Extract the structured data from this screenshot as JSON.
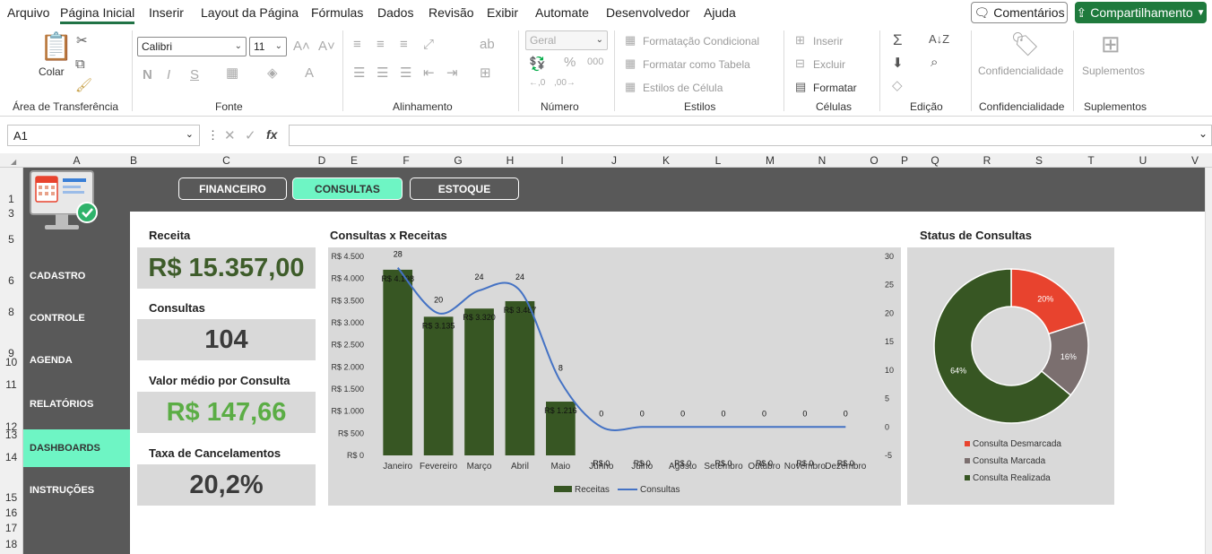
{
  "menu": {
    "items": [
      "Arquivo",
      "Página Inicial",
      "Inserir",
      "Layout da Página",
      "Fórmulas",
      "Dados",
      "Revisão",
      "Exibir",
      "Automate",
      "Desenvolvedor",
      "Ajuda"
    ],
    "comments": "Comentários",
    "share": "Compartilhamento"
  },
  "ribbon": {
    "clipboard": {
      "paste": "Colar",
      "label": "Área de Transferência"
    },
    "font": {
      "name": "Calibri",
      "size": "11",
      "label": "Fonte"
    },
    "alignment": {
      "label": "Alinhamento"
    },
    "number": {
      "format": "Geral",
      "label": "Número"
    },
    "styles": {
      "conditional": "Formatação Condicional",
      "table": "Formatar como Tabela",
      "cell": "Estilos de Célula",
      "label": "Estilos"
    },
    "cells": {
      "insert": "Inserir",
      "delete": "Excluir",
      "format": "Formatar",
      "label": "Células"
    },
    "editing": {
      "label": "Edição"
    },
    "sensitivity": {
      "button": "Confidencialidade",
      "label": "Confidencialidade"
    },
    "addins": {
      "button": "Suplementos",
      "label": "Suplementos"
    }
  },
  "formula_bar": {
    "name_box": "A1",
    "fx": "fx",
    "value": ""
  },
  "columns": [
    "A",
    "B",
    "C",
    "D",
    "E",
    "F",
    "G",
    "H",
    "I",
    "J",
    "K",
    "L",
    "M",
    "N",
    "O",
    "P",
    "Q",
    "R",
    "S",
    "T",
    "U",
    "V"
  ],
  "rows": [
    "1",
    "3",
    "5",
    "6",
    "8",
    "9",
    "10",
    "11",
    "12",
    "13",
    "14",
    "15",
    "16",
    "17",
    "18"
  ],
  "dashboard": {
    "nav": [
      "FINANCEIRO",
      "CONSULTAS",
      "ESTOQUE"
    ],
    "nav_active": "CONSULTAS",
    "sidebar": [
      "CADASTRO",
      "CONTROLE",
      "AGENDA",
      "RELATÓRIOS",
      "DASHBOARDS",
      "INSTRUÇÕES"
    ],
    "sidebar_active": "DASHBOARDS",
    "kpis": [
      {
        "title": "Receita",
        "value": "R$ 15.357,00",
        "color": "#3e5c2a"
      },
      {
        "title": "Consultas",
        "value": "104",
        "color": "#3b3b3b"
      },
      {
        "title": "Valor médio por Consulta",
        "value": "R$ 147,66",
        "color": "#5bad45"
      },
      {
        "title": "Taxa de Cancelamentos",
        "value": "20,2%",
        "color": "#3b3b3b"
      }
    ]
  },
  "chart_data": [
    {
      "type": "bar",
      "title": "Consultas x Receitas",
      "categories": [
        "Janeiro",
        "Fevereiro",
        "Março",
        "Abril",
        "Maio",
        "Junho",
        "Julho",
        "Agosto",
        "Setembro",
        "Outubro",
        "Novembro",
        "Dezembro"
      ],
      "series": [
        {
          "name": "Receitas",
          "type": "bar",
          "axis": "left",
          "color": "#375623",
          "values": [
            4198,
            3135,
            3320,
            3487,
            1216,
            0,
            0,
            0,
            0,
            0,
            0,
            0
          ],
          "labels": [
            "R$ 4.198",
            "R$ 3.135",
            "R$ 3.320",
            "R$ 3.487",
            "R$ 1.216",
            "R$ 0",
            "R$ 0",
            "R$ 0",
            "R$ 0",
            "R$ 0",
            "R$ 0",
            "R$ 0"
          ]
        },
        {
          "name": "Consultas",
          "type": "line",
          "axis": "right",
          "color": "#4472c4",
          "values": [
            28,
            20,
            24,
            24,
            8,
            0,
            0,
            0,
            0,
            0,
            0,
            0
          ]
        }
      ],
      "yleft": {
        "ticks": [
          "R$ 0",
          "R$ 500",
          "R$ 1.000",
          "R$ 1.500",
          "R$ 2.000",
          "R$ 2.500",
          "R$ 3.000",
          "R$ 3.500",
          "R$ 4.000",
          "R$ 4.500"
        ],
        "range": [
          0,
          4500
        ]
      },
      "yright": {
        "ticks": [
          "-5",
          "0",
          "5",
          "10",
          "15",
          "20",
          "25",
          "30"
        ],
        "range": [
          -5,
          30
        ]
      },
      "legend": "bottom",
      "grid": false
    },
    {
      "type": "pie",
      "title": "Status de Consultas",
      "donut": true,
      "slices": [
        {
          "name": "Consulta Desmarcada",
          "value": 20,
          "label": "20%",
          "color": "#e8432e"
        },
        {
          "name": "Consulta Marcada",
          "value": 16,
          "label": "16%",
          "color": "#7b6f6f"
        },
        {
          "name": "Consulta Realizada",
          "value": 64,
          "label": "64%",
          "color": "#375623"
        }
      ],
      "legend": "bottom"
    }
  ]
}
